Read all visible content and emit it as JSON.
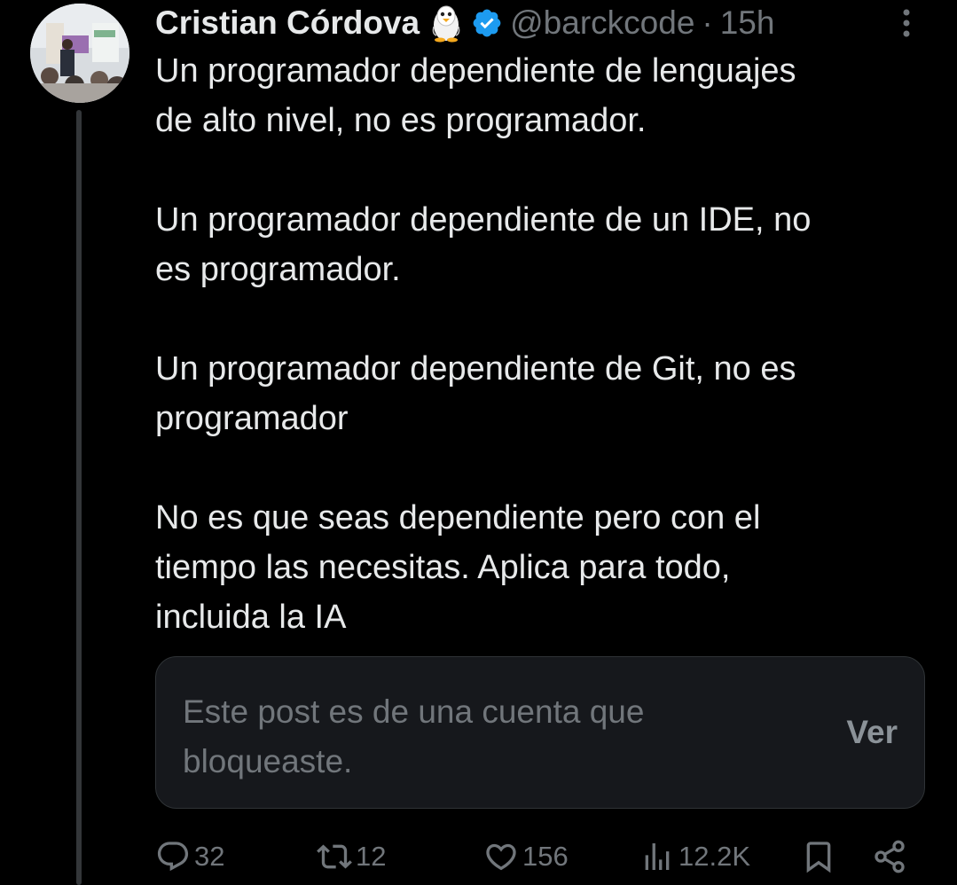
{
  "author": {
    "display_name": "Cristian Córdova",
    "handle": "@barckcode",
    "separator": "·",
    "time": "15h",
    "verified": true,
    "emoji_icon": "penguin-emoji",
    "verified_color": "#1d9bf0"
  },
  "tweet": {
    "paragraphs": [
      "Un programador dependiente de lenguajes\nde alto nivel, no es programador.",
      "Un programador dependiente de un IDE, no\nes programador.",
      "Un programador dependiente de Git, no es\nprogramador",
      "No es que seas dependiente pero con el\ntiempo las necesitas. Aplica para todo,\nincluida la IA"
    ]
  },
  "blocked_post": {
    "message": "Este post es de una cuenta que bloqueaste.",
    "button_label": "Ver"
  },
  "actions": {
    "replies": "32",
    "reposts": "12",
    "likes": "156",
    "views": "12.2K"
  },
  "colors": {
    "background": "#000000",
    "text": "#e7e9ea",
    "muted": "#71767b",
    "card": "#16181c"
  }
}
